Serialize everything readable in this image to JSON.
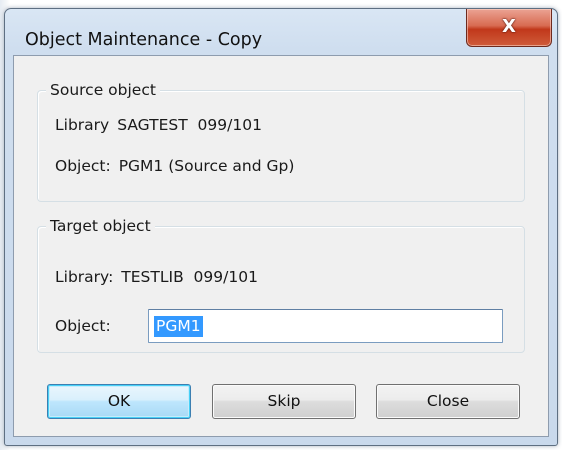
{
  "window": {
    "title": "Object Maintenance - Copy",
    "close_glyph": "X"
  },
  "source": {
    "legend": "Source object",
    "library_label": "Library",
    "library_value": "SAGTEST  099/101",
    "object_label": "Object:",
    "object_value": "PGM1 (Source and Gp)"
  },
  "target": {
    "legend": "Target object",
    "library_label": "Library:",
    "library_value": "TESTLIB  099/101",
    "object_label": "Object:",
    "object_input_value": "PGM1"
  },
  "buttons": {
    "ok": "OK",
    "skip": "Skip",
    "close": "Close"
  },
  "colors": {
    "selection": "#3399ff",
    "close_button": "#c1381b",
    "default_button_border": "#3c7fb1"
  },
  "icons": {
    "close": "close-icon"
  }
}
